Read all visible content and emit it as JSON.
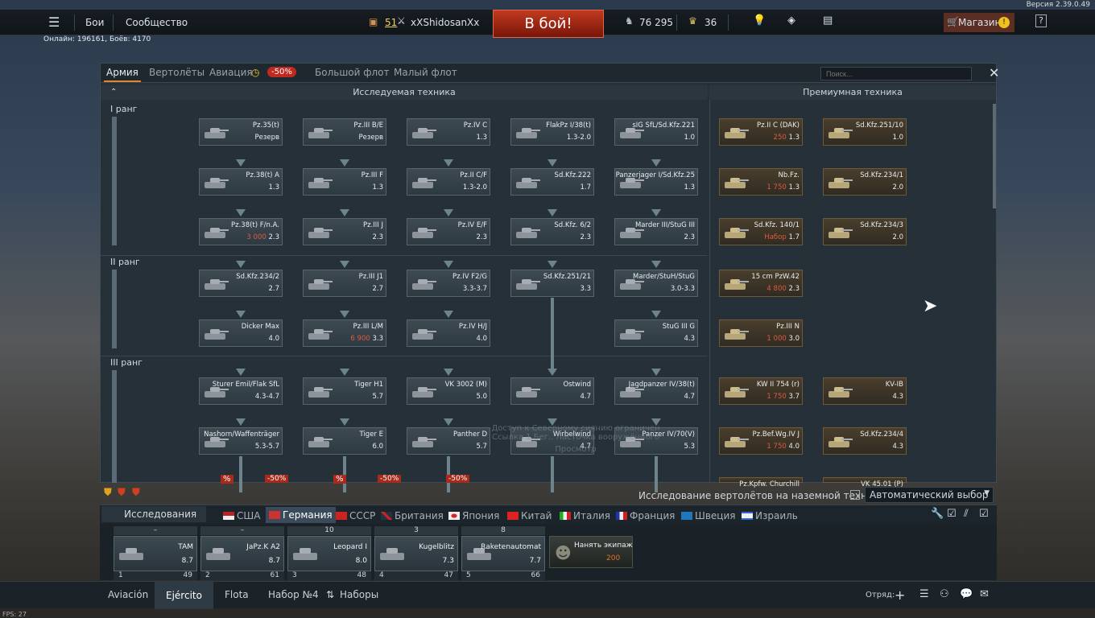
{
  "version": "Версия 2.39.0.49",
  "online": "Онлайн: 196161, Боёв: 4170",
  "fps": "FPS: 27",
  "topbar": {
    "menu_battles": "Бои",
    "menu_community": "Сообщество",
    "level": "51",
    "player": "xXShidosanXx",
    "battle_button": "В бой!",
    "silver": "76 295",
    "gold": "36",
    "shop": "Магазин"
  },
  "tabs": [
    {
      "label": "Армия"
    },
    {
      "label": "Вертолёты"
    },
    {
      "label": "Авиация"
    },
    {
      "label": "Большой флот"
    },
    {
      "label": "Малый флот"
    }
  ],
  "discount": "-50%",
  "search_placeholder": "Поиск...",
  "researched_header": "Исследуемая техника",
  "premium_header": "Премиумная техника",
  "ranks": [
    "I ранг",
    "II ранг",
    "III ранг"
  ],
  "tree": [
    {
      "name": "Pz.35(t)",
      "br": "Резерв"
    },
    {
      "name": "Pz.III B/E",
      "br": "Резерв"
    },
    {
      "name": "Pz.IV C",
      "br": "1.3"
    },
    {
      "name": "FlakPz I/38(t)",
      "br": "1.3-2.0"
    },
    {
      "name": "sIG SfL/Sd.Kfz.221",
      "br": "1.0"
    },
    {
      "name": "Pz.38(t) A",
      "br": "1.3"
    },
    {
      "name": "Pz.III F",
      "br": "1.3"
    },
    {
      "name": "Pz.II C/F",
      "br": "1.3-2.0"
    },
    {
      "name": "Sd.Kfz.222",
      "br": "1.7"
    },
    {
      "name": "Panzerjager I/Sd.Kfz.25",
      "br": "1.3"
    },
    {
      "name": "Pz.38(t) F/n.A.",
      "br": "2.3",
      "cost": "3 000"
    },
    {
      "name": "Pz.III J",
      "br": "2.3"
    },
    {
      "name": "Pz.IV E/F",
      "br": "2.3"
    },
    {
      "name": "Sd.Kfz. 6/2",
      "br": "2.3"
    },
    {
      "name": "Marder III/StuG III",
      "br": "2.3"
    },
    {
      "name": "Sd.Kfz.234/2",
      "br": "2.7"
    },
    {
      "name": "Pz.III J1",
      "br": "2.7"
    },
    {
      "name": "Pz.IV F2/G",
      "br": "3.3-3.7"
    },
    {
      "name": "Sd.Kfz.251/21",
      "br": "3.3"
    },
    {
      "name": "Marder/StuH/StuG",
      "br": "3.0-3.3"
    },
    {
      "name": "Dicker Max",
      "br": "4.0"
    },
    {
      "name": "Pz.III L/M",
      "br": "3.3",
      "cost": "6 900"
    },
    {
      "name": "Pz.IV H/J",
      "br": "4.0"
    },
    {
      "name": "StuG III G",
      "br": "4.3"
    },
    {
      "name": "Sturer Emil/Flak SfL",
      "br": "4.3-4.7"
    },
    {
      "name": "Tiger H1",
      "br": "5.7"
    },
    {
      "name": "VK 3002 (M)",
      "br": "5.0"
    },
    {
      "name": "Ostwind",
      "br": "4.7"
    },
    {
      "name": "Jagdpanzer IV/38(t)",
      "br": "4.7"
    },
    {
      "name": "Nashorn/Waffenträger",
      "br": "5.3-5.7"
    },
    {
      "name": "Tiger E",
      "br": "6.0"
    },
    {
      "name": "Panther D",
      "br": "5.7"
    },
    {
      "name": "Wirbelwind",
      "br": "4.7"
    },
    {
      "name": "Panzer IV/70(V)",
      "br": "5.3"
    }
  ],
  "premium": [
    {
      "name": "Pz.II C (DAK)",
      "br": "1.3",
      "cost": "250"
    },
    {
      "name": "Sd.Kfz.251/10",
      "br": "1.0"
    },
    {
      "name": "Nb.Fz.",
      "br": "1.3",
      "cost": "1 750"
    },
    {
      "name": "Sd.Kfz.234/1",
      "br": "2.0"
    },
    {
      "name": "Sd.Kfz. 140/1",
      "br": "1.7",
      "cost": "Набор"
    },
    {
      "name": "Sd.Kfz.234/3",
      "br": "2.0"
    },
    {
      "name": "15 cm PzW.42",
      "br": "2.3",
      "cost": "4 800"
    },
    {
      "name": "Pz.III N",
      "br": "3.0",
      "cost": "1 000"
    },
    {
      "name": "KW II 754 (r)",
      "br": "3.7",
      "cost": "1 750"
    },
    {
      "name": "KV-IB",
      "br": "4.3"
    },
    {
      "name": "Pz.Bef.Wg.IV J",
      "br": "4.0",
      "cost": "1 750"
    },
    {
      "name": "Sd.Kfz.234/4",
      "br": "4.3"
    },
    {
      "name": "Pz.Kpfw. Churchill",
      "br": ""
    },
    {
      "name": "VK 45.01 (P)",
      "br": ""
    }
  ],
  "overlay": {
    "line1": "Доступ к Северному сиянию ограничен",
    "line2": "Ссылка 1 Бег.. Ласточка вооружённого",
    "view": "Просмотр"
  },
  "helicopter_research": "Исследование вертолётов на наземной технике",
  "auto_select": "Автоматический выбор",
  "research_tab": "Исследования",
  "countries": [
    {
      "label": "США"
    },
    {
      "label": "Германия"
    },
    {
      "label": "СССР"
    },
    {
      "label": "Британия"
    },
    {
      "label": "Япония"
    },
    {
      "label": "Китай"
    },
    {
      "label": "Италия"
    },
    {
      "label": "Франция"
    },
    {
      "label": "Швеция"
    },
    {
      "label": "Израиль"
    }
  ],
  "crew": [
    {
      "top": "–",
      "name": "TAM",
      "br": "8.7",
      "num": "1",
      "pts": "49"
    },
    {
      "top": "–",
      "name": "JaPz.K A2",
      "br": "8.7",
      "num": "2",
      "pts": "61"
    },
    {
      "top": "10",
      "name": "Leopard I",
      "br": "8.0",
      "num": "3",
      "pts": "48"
    },
    {
      "top": "3",
      "name": "Kugelblitz",
      "br": "7.3",
      "num": "4",
      "pts": "47"
    },
    {
      "top": "8",
      "name": "Raketenautomat",
      "br": "7.7",
      "num": "5",
      "pts": "66"
    }
  ],
  "hire": {
    "label": "Нанять экипаж",
    "cost": "200"
  },
  "bottom": {
    "aviation": "Aviación",
    "army": "Ejército",
    "fleet": "Flota",
    "preset": "Набор №4",
    "presets": "Наборы",
    "squad": "Отряд:"
  }
}
